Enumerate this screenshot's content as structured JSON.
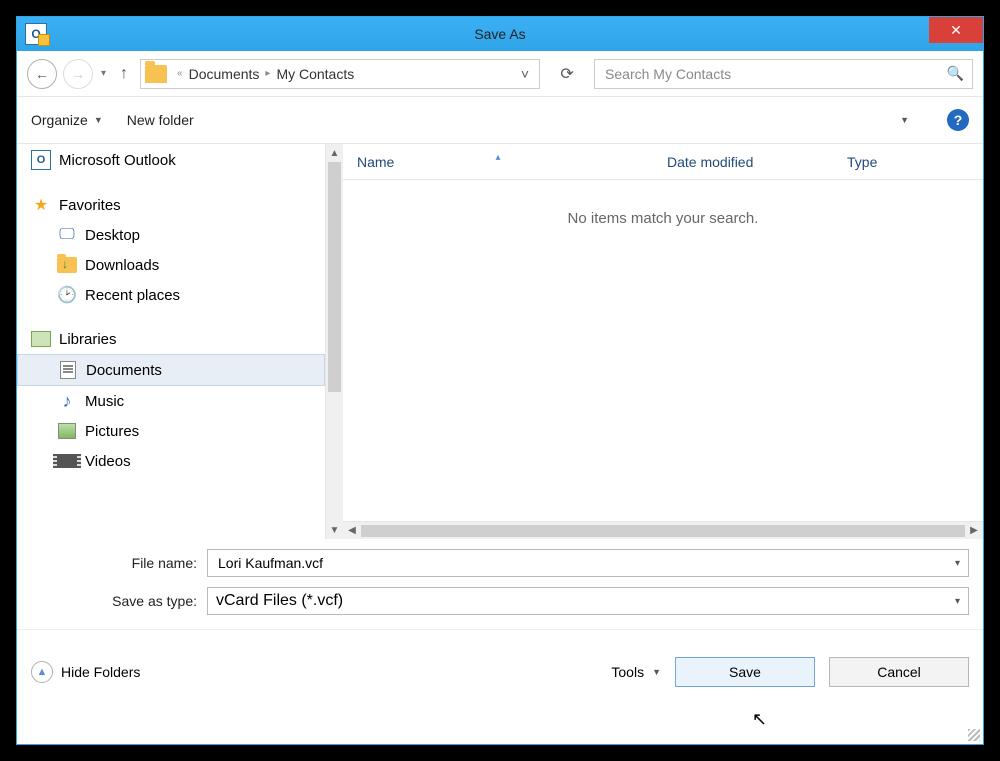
{
  "window": {
    "title": "Save As"
  },
  "nav": {
    "breadcrumb": {
      "part1": "Documents",
      "part2": "My Contacts"
    },
    "search_placeholder": "Search My Contacts"
  },
  "toolbar": {
    "organize": "Organize",
    "new_folder": "New folder"
  },
  "sidebar": {
    "outlook": "Microsoft Outlook",
    "favorites": "Favorites",
    "desktop": "Desktop",
    "downloads": "Downloads",
    "recent": "Recent places",
    "libraries": "Libraries",
    "documents": "Documents",
    "music": "Music",
    "pictures": "Pictures",
    "videos": "Videos"
  },
  "columns": {
    "name": "Name",
    "date": "Date modified",
    "type": "Type"
  },
  "list": {
    "empty": "No items match your search."
  },
  "form": {
    "filename_label": "File name:",
    "filename_value": "Lori Kaufman.vcf",
    "type_label": "Save as type:",
    "type_value": "vCard Files (*.vcf)"
  },
  "footer": {
    "hide_folders": "Hide Folders",
    "tools": "Tools",
    "save": "Save",
    "cancel": "Cancel"
  }
}
